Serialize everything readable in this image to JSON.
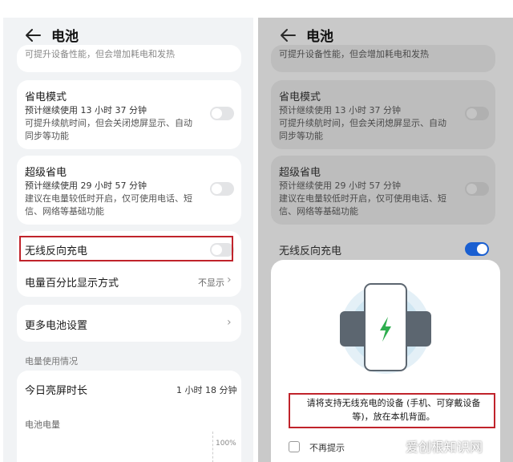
{
  "header": {
    "title": "电池"
  },
  "left": {
    "top_clipped_text": "可提升设备性能，但会增加耗电和发热",
    "power_saving": {
      "title": "省电模式",
      "estimate": "预计继续使用 13 小时 37 分钟",
      "desc_line1": "可提升续航时间，但会关闭熄屏显示、自动",
      "desc_line2": "同步等功能"
    },
    "super_saving": {
      "title": "超级省电",
      "estimate": "预计继续使用 29 小时 57 分钟",
      "desc_line1": "建议在电量较低时开启，仅可使用电话、短",
      "desc_line2": "信、网络等基础功能"
    },
    "wireless_reverse": {
      "title": "无线反向充电",
      "enabled": false
    },
    "percent_display": {
      "title": "电量百分比显示方式",
      "value": "不显示"
    },
    "more_settings": {
      "title": "更多电池设置"
    },
    "usage_section": "电量使用情况",
    "screen_time": {
      "title": "今日亮屏时长",
      "value": "1 小时 18 分钟"
    },
    "battery_level": {
      "title": "电池电量",
      "axis_top": "100%"
    }
  },
  "right": {
    "top_clipped_text": "可提升设备性能，但会增加耗电和发热",
    "power_saving": {
      "title": "省电模式",
      "estimate": "预计继续使用 13 小时 37 分钟",
      "desc_line1": "可提升续航时间，但会关闭熄屏显示、自动",
      "desc_line2": "同步等功能"
    },
    "super_saving": {
      "title": "超级省电",
      "estimate": "预计继续使用 29 小时 57 分钟",
      "desc_line1": "建议在电量较低时开启，仅可使用电话、短",
      "desc_line2": "信、网络等基础功能"
    },
    "wireless_reverse": {
      "title": "无线反向充电",
      "enabled": true
    },
    "sheet": {
      "instruction_line1": "请将支持无线充电的设备 (手机、可穿戴设备",
      "instruction_line2": "等)，放在本机背面。",
      "checkbox_label": "不再提示"
    }
  },
  "watermark": "爱创根知识网",
  "colors": {
    "accent": "#1a5fd1",
    "highlight": "#c0232b",
    "charge_bolt": "#2eae4f"
  }
}
